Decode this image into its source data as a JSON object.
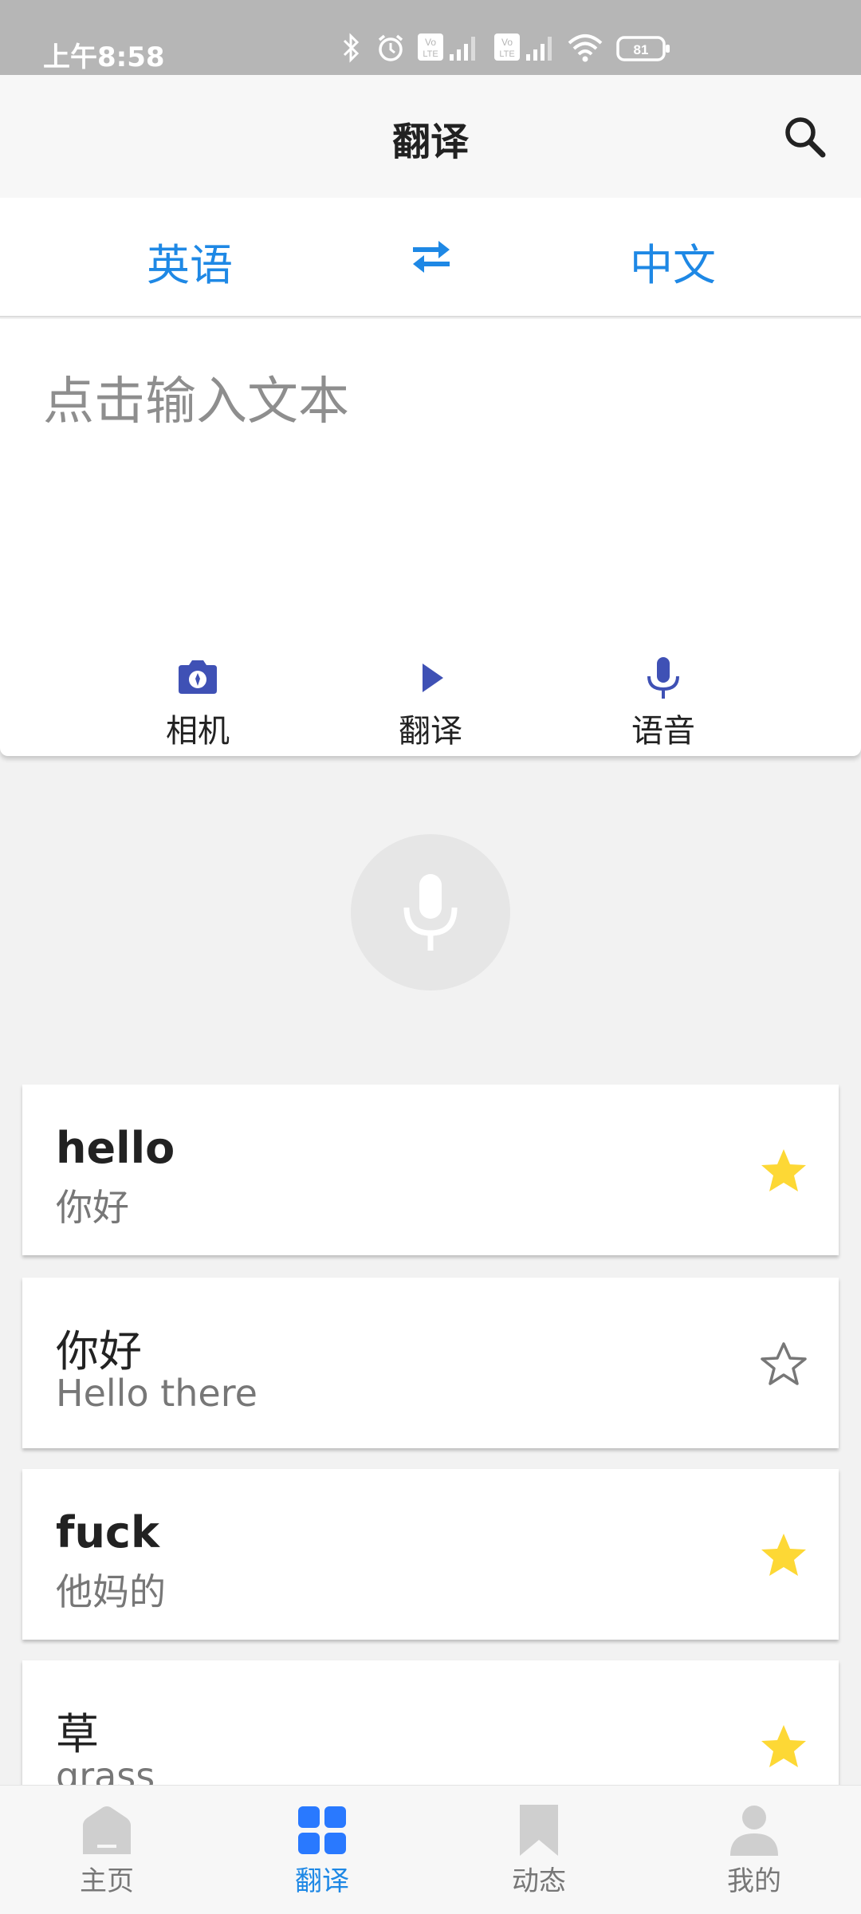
{
  "status_bar": {
    "time": "上午8:58",
    "battery": "81",
    "icons": [
      "bluetooth-icon",
      "alarm-icon",
      "volte-icon",
      "signal-icon",
      "volte-icon",
      "signal-icon",
      "wifi-icon",
      "battery-icon"
    ]
  },
  "header": {
    "title": "翻译",
    "search_icon": "search-icon"
  },
  "languages": {
    "source": "英语",
    "target": "中文",
    "swap_icon": "swap-arrows-icon"
  },
  "input": {
    "placeholder": "点击输入文本",
    "value": ""
  },
  "actions": [
    {
      "label": "相机",
      "icon": "camera-icon"
    },
    {
      "label": "翻译",
      "icon": "play-icon"
    },
    {
      "label": "语音",
      "icon": "mic-icon"
    }
  ],
  "big_mic": {
    "icon": "mic-icon"
  },
  "history": [
    {
      "source": "hello",
      "translation": "你好",
      "starred": true
    },
    {
      "source": "你好",
      "translation": "Hello there",
      "starred": false
    },
    {
      "source": "fuck",
      "translation": "他妈的",
      "starred": true
    },
    {
      "source": "草",
      "translation": "grass",
      "starred": true
    }
  ],
  "bottom_nav": [
    {
      "label": "主页",
      "icon": "home-icon",
      "active": false
    },
    {
      "label": "翻译",
      "icon": "grid-icon",
      "active": true
    },
    {
      "label": "动态",
      "icon": "bookmark-icon",
      "active": false
    },
    {
      "label": "我的",
      "icon": "person-icon",
      "active": false
    }
  ],
  "colors": {
    "accent": "#1e88e5",
    "icon_indigo": "#3f51b5",
    "star": "#fdd835",
    "status_bar": "#b6b6b6"
  }
}
